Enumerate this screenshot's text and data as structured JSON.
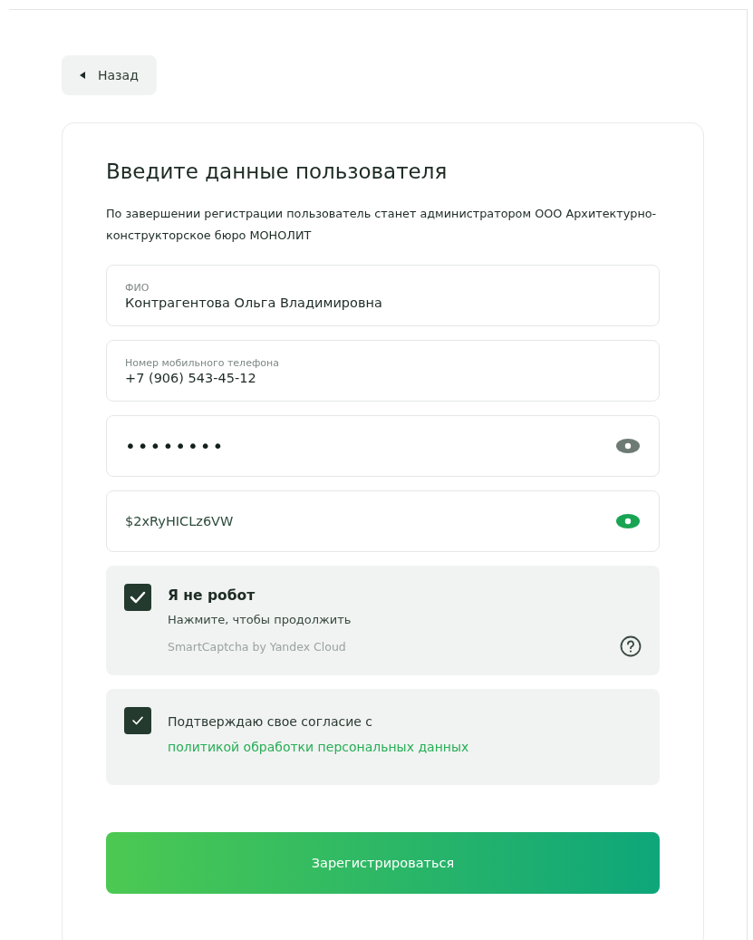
{
  "back_button": {
    "label": "Назад"
  },
  "form": {
    "title": "Введите данные пользователя",
    "description": "По завершении регистрации пользователь станет администратором ООО Архитектурно-конструкторское бюро МОНОЛИТ",
    "fields": [
      {
        "kind": "text",
        "label": "ФИО",
        "value": "Контрагентова Ольга Владимировна"
      },
      {
        "kind": "text",
        "label": "Номер мобильного телефона",
        "value": "+7 (906) 543-45-12"
      },
      {
        "kind": "password",
        "value": "••••••••",
        "revealed": false
      },
      {
        "kind": "password",
        "value": "$2xRyHICLz6VW",
        "revealed": true
      }
    ],
    "captcha": {
      "checked": true,
      "title": "Я не робот",
      "hint": "Нажмите, чтобы продолжить",
      "provider": "SmartCaptcha by Yandex Cloud"
    },
    "consent": {
      "checked": true,
      "text": "Подтверждаю свое согласие с",
      "link": "политикой обработки персональных данных"
    },
    "submit_button": {
      "label": "Зарегистрироваться"
    }
  }
}
